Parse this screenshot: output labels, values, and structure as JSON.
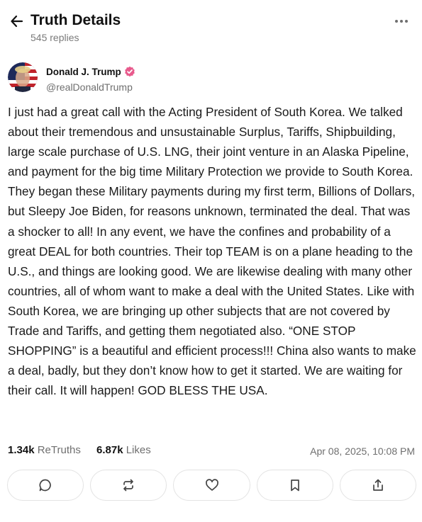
{
  "header": {
    "title": "Truth Details",
    "replies": "545 replies",
    "back_icon": "arrow-left-icon",
    "more_icon": "more-horizontal-icon"
  },
  "author": {
    "name": "Donald J. Trump",
    "handle": "@realDonaldTrump",
    "verified_color": "#e85a8c"
  },
  "post": {
    "text": "I just had a great call with the Acting President of South Korea. We talked about their tremendous and unsustainable Surplus, Tariffs, Shipbuilding, large scale purchase of U.S. LNG, their joint venture in an Alaska Pipeline, and payment for the big time Military Protection we provide to South Korea. They began these Military payments during my first term, Billions of Dollars, but Sleepy Joe Biden, for reasons unknown, terminated the deal. That was a shocker to all! In any event, we have the confines and probability of a great DEAL for both countries. Their top TEAM is on a plane heading to the U.S., and things are looking good. We are likewise dealing with many other countries, all of whom want to make a deal with the United States. Like with South Korea, we are bringing up other subjects that are not covered by Trade and Tariffs, and getting them negotiated also. “ONE STOP SHOPPING” is a beautiful and efficient process!!! China also wants to make a deal, badly, but they don’t know how to get it started. We are waiting for their call. It will happen! GOD BLESS THE USA."
  },
  "stats": {
    "retruths_count": "1.34k",
    "retruths_label": "ReTruths",
    "likes_count": "6.87k",
    "likes_label": "Likes",
    "timestamp": "Apr 08, 2025, 10:08 PM"
  },
  "actions": [
    {
      "icon": "reply-icon"
    },
    {
      "icon": "retruth-icon"
    },
    {
      "icon": "like-icon"
    },
    {
      "icon": "bookmark-icon"
    },
    {
      "icon": "share-icon"
    }
  ],
  "colors": {
    "text": "#1a1a1a",
    "muted": "#6f6f6f",
    "border": "#e3e3e3"
  }
}
